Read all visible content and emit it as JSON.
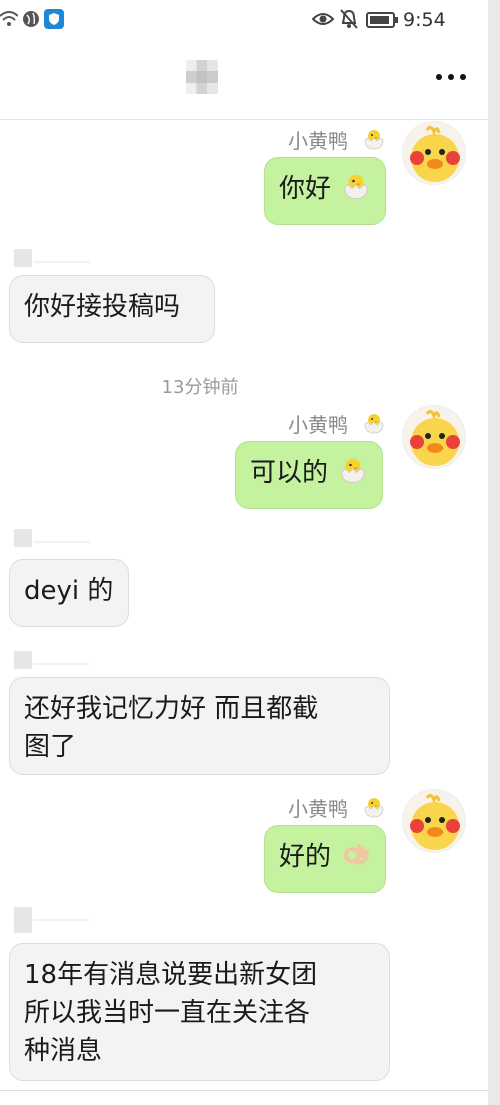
{
  "status_bar": {
    "time": "9:54",
    "icons": [
      "wifi-icon",
      "globe-icon",
      "shield-app-icon",
      "eye-icon",
      "bell-muted-icon",
      "battery-icon"
    ]
  },
  "header": {
    "title": "",
    "more_icon": "more-dots-icon"
  },
  "chat": {
    "timestamp": "13分钟前",
    "messages": [
      {
        "direction": "out",
        "sender": "小黄鸭",
        "text": "你好",
        "emoji": "hatching-chick"
      },
      {
        "direction": "in",
        "text": "你好接投稿吗"
      },
      {
        "direction": "out",
        "sender": "小黄鸭",
        "text": "可以的",
        "emoji": "hatching-chick"
      },
      {
        "direction": "in",
        "text": "deyi 的"
      },
      {
        "direction": "in",
        "text_lines": [
          "还好我记忆力好 而且都截",
          "图了"
        ]
      },
      {
        "direction": "out",
        "sender": "小黄鸭",
        "text": "好的",
        "emoji": "ok-hand"
      },
      {
        "direction": "in",
        "text_lines": [
          "18年有消息说要出新女团",
          "所以我当时一直在关注各",
          "种消息"
        ]
      }
    ]
  },
  "colors": {
    "outgoing_bubble": "#c5f29f",
    "incoming_bubble": "#f3f3f3",
    "meta_text": "#8a8a8a"
  }
}
